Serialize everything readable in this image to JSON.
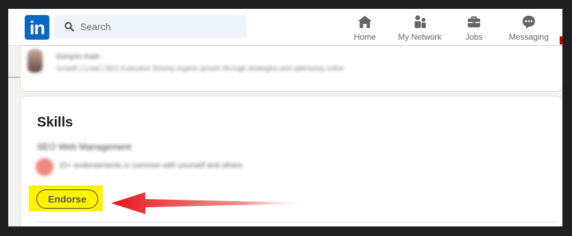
{
  "nav": {
    "logo": "in",
    "search_placeholder": "Search",
    "items": [
      {
        "label": "Home",
        "icon": "home-icon"
      },
      {
        "label": "My Network",
        "icon": "network-icon"
      },
      {
        "label": "Jobs",
        "icon": "briefcase-icon"
      },
      {
        "label": "Messaging",
        "icon": "message-icon"
      }
    ]
  },
  "profile": {
    "name": "Kenyon Irwin",
    "headline": "Growth | Lead | SEO Executive Driving organic growth through strategies and optimizing online"
  },
  "skills": {
    "title": "Skills",
    "skill_name": "SEO Web Management",
    "endorsement_text": "15+ endorsements in common with yourself and others",
    "endorse_label": "Endorse"
  },
  "colors": {
    "brand": "#0a66c2",
    "highlight": "#fff200",
    "arrow": "#e8141b"
  }
}
